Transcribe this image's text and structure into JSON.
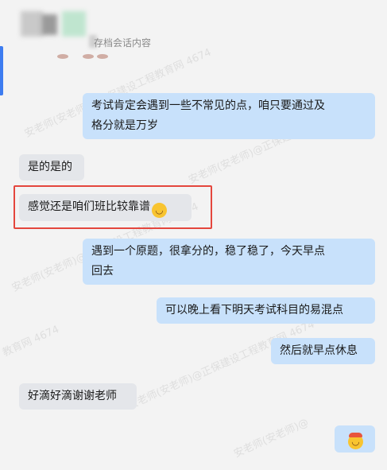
{
  "header": {
    "archive_label": "存档会话内容"
  },
  "watermark": {
    "text_a": "安老师(安老师)@正保建设工程教育网 4674",
    "text_b": "安老师(安老师)@正保建设工程教育网",
    "text_c": "教育网 4674",
    "text_d": "安老师(安老师)@",
    "text_e": "安老师(安老师)@正保建设工程教育网 4674"
  },
  "messages": [
    {
      "side": "right",
      "line1": "考试肯定会遇到一些不常见的点，咱只要通过及",
      "line2": "格分就是万岁"
    },
    {
      "side": "left",
      "text": "是的是的"
    },
    {
      "side": "left",
      "text": "感觉还是咱们班比较靠谱",
      "emoji": "crying-laughing-emoji",
      "highlighted": true
    },
    {
      "side": "right",
      "line1": "遇到一个原题，很拿分的，稳了稳了，今天早点",
      "line2": "回去"
    },
    {
      "side": "right",
      "text": "可以晚上看下明天考试科目的易混点"
    },
    {
      "side": "right",
      "text": "然后就早点休息"
    },
    {
      "side": "left",
      "text": "好滴好滴谢谢老师"
    },
    {
      "side": "right",
      "emoji": "party-emoji"
    }
  ],
  "colors": {
    "right_bubble": "#c8e1fb",
    "left_bubble": "#e4e6ea",
    "highlight": "#e4463d",
    "accent": "#3d7cf0"
  }
}
